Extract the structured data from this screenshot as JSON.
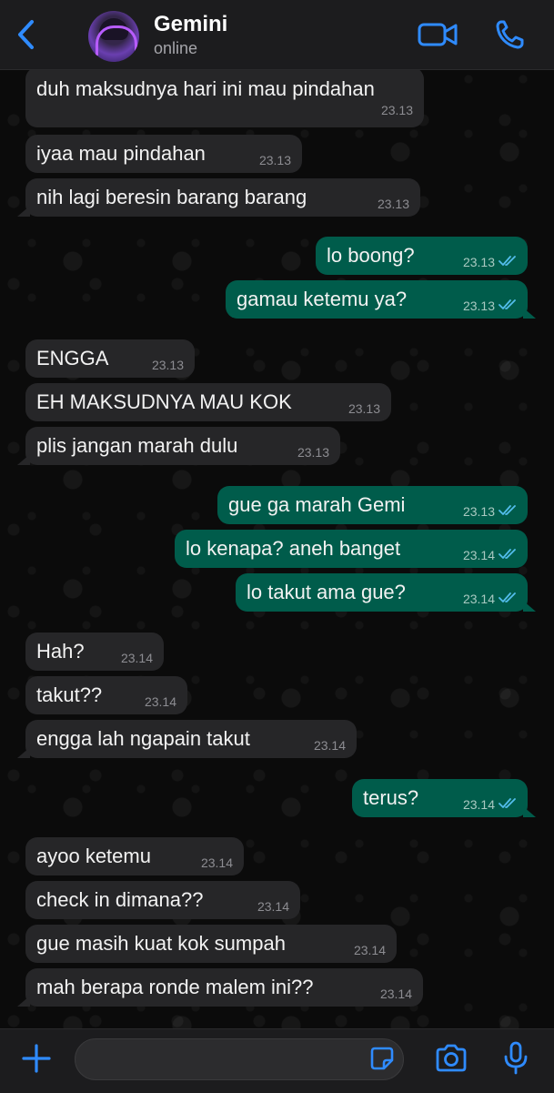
{
  "header": {
    "contact_name": "Gemini",
    "status": "online",
    "back_icon": "chevron-left-icon",
    "video_icon": "video-camera-icon",
    "call_icon": "phone-icon"
  },
  "messages": [
    {
      "dir": "in",
      "text": "duh maksudnya hari ini mau pindahan",
      "time": "23.13"
    },
    {
      "dir": "in",
      "text": "iyaa mau pindahan",
      "time": "23.13"
    },
    {
      "dir": "in",
      "text": "nih lagi beresin barang barang",
      "time": "23.13"
    },
    {
      "dir": "out",
      "text": "lo boong?",
      "time": "23.13"
    },
    {
      "dir": "out",
      "text": "gamau ketemu ya?",
      "time": "23.13"
    },
    {
      "dir": "in",
      "text": "ENGGA",
      "time": "23.13"
    },
    {
      "dir": "in",
      "text": "EH MAKSUDNYA MAU KOK",
      "time": "23.13"
    },
    {
      "dir": "in",
      "text": "plis jangan marah dulu",
      "time": "23.13"
    },
    {
      "dir": "out",
      "text": "gue ga marah Gemi",
      "time": "23.13"
    },
    {
      "dir": "out",
      "text": "lo kenapa? aneh banget",
      "time": "23.14"
    },
    {
      "dir": "out",
      "text": "lo takut ama gue?",
      "time": "23.14"
    },
    {
      "dir": "in",
      "text": "Hah?",
      "time": "23.14"
    },
    {
      "dir": "in",
      "text": "takut??",
      "time": "23.14"
    },
    {
      "dir": "in",
      "text": "engga lah ngapain takut",
      "time": "23.14"
    },
    {
      "dir": "out",
      "text": "terus?",
      "time": "23.14"
    },
    {
      "dir": "in",
      "text": "ayoo ketemu",
      "time": "23.14"
    },
    {
      "dir": "in",
      "text": "check in dimana??",
      "time": "23.14"
    },
    {
      "dir": "in",
      "text": "gue masih kuat kok sumpah",
      "time": "23.14"
    },
    {
      "dir": "in",
      "text": "mah berapa ronde malem ini??",
      "time": "23.14"
    }
  ],
  "composer": {
    "input_value": "",
    "add_icon": "plus-icon",
    "sticker_icon": "sticker-icon",
    "camera_icon": "camera-icon",
    "mic_icon": "microphone-icon"
  },
  "colors": {
    "accent": "#2f8bff",
    "incoming_bubble": "#262628",
    "outgoing_bubble": "#005c4b",
    "read_check": "#53bdeb"
  }
}
